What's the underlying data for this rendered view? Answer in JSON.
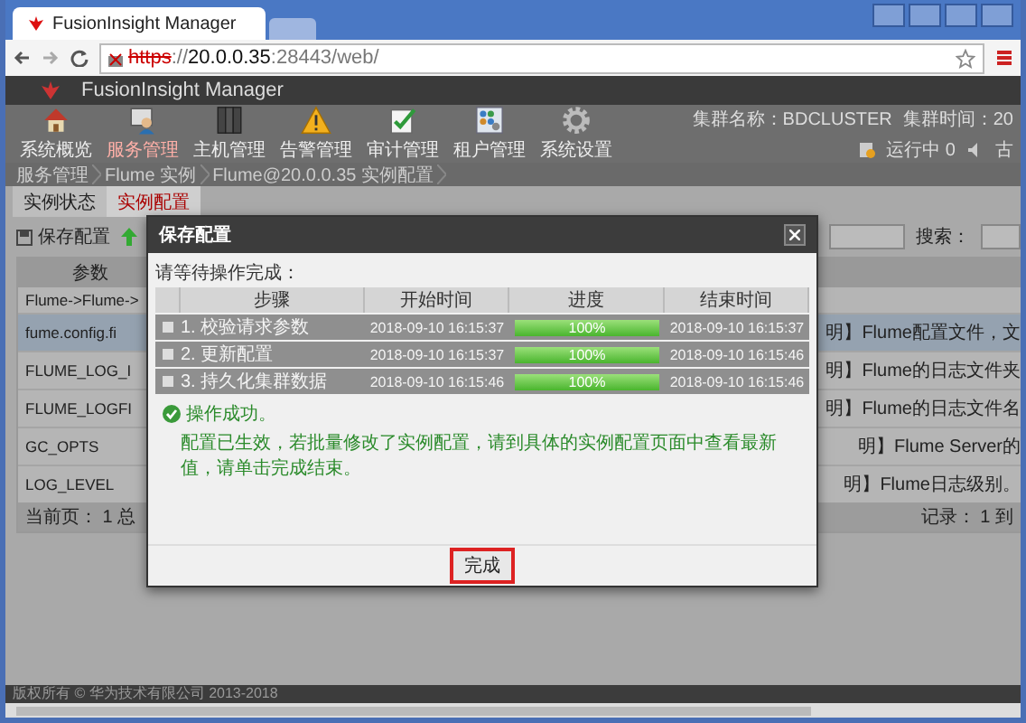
{
  "browser": {
    "tab_title": "FusionInsight Manager",
    "url_scheme": "https",
    "url_sep": "://",
    "url_host": "20.0.0.35",
    "url_rest": ":28443/web/"
  },
  "app": {
    "title": "FusionInsight Manager"
  },
  "nav": [
    {
      "kind": "home",
      "label": "系统概览",
      "selected": false
    },
    {
      "kind": "service",
      "label": "服务管理",
      "selected": true
    },
    {
      "kind": "host",
      "label": "主机管理",
      "selected": false
    },
    {
      "kind": "alarm",
      "label": "告警管理",
      "selected": false
    },
    {
      "kind": "audit",
      "label": "审计管理",
      "selected": false
    },
    {
      "kind": "tenant",
      "label": "租户管理",
      "selected": false
    },
    {
      "kind": "settings",
      "label": "系统设置",
      "selected": false
    }
  ],
  "cluster": {
    "name": "集群名称：BDCLUSTER",
    "time": "集群时间：20",
    "running": "运行中 0",
    "extra": "古"
  },
  "breadcrumb": [
    "服务管理",
    "Flume 实例",
    "Flume@20.0.0.35 实例配置"
  ],
  "page_tabs": [
    {
      "label": "实例状态",
      "selected": false
    },
    {
      "label": "实例配置",
      "selected": true
    }
  ],
  "toolbar": {
    "save": "保存配置",
    "search_label": "搜索："
  },
  "table": {
    "header": "参数",
    "group": "Flume->Flume->",
    "rows": [
      {
        "name": "fume.config.fi",
        "description": "明】Flume配置文件，文",
        "selected": true
      },
      {
        "name": "FLUME_LOG_I",
        "description": "明】Flume的日志文件夹",
        "selected": false
      },
      {
        "name": "FLUME_LOGFI",
        "description": "明】Flume的日志文件名",
        "selected": false
      },
      {
        "name": "GC_OPTS",
        "description": "明】Flume Server的",
        "selected": false
      },
      {
        "name": "LOG_LEVEL",
        "description": "明】Flume日志级别。",
        "selected": false
      }
    ],
    "footer_left": "当前页： 1 总",
    "footer_right": "记录： 1 到"
  },
  "dialog": {
    "title": "保存配置",
    "prompt": "请等待操作完成：",
    "columns": [
      "步骤",
      "开始时间",
      "进度",
      "结束时间"
    ],
    "steps": [
      {
        "label": "1. 校验请求参数",
        "start": "2018-09-10 16:15:37",
        "level": 1,
        "percent": "100%",
        "end": "2018-09-10 16:15:37"
      },
      {
        "label": "2. 更新配置",
        "start": "2018-09-10 16:15:37",
        "level": 1,
        "percent": "100%",
        "end": "2018-09-10 16:15:46"
      },
      {
        "label": "3. 持久化集群数据",
        "start": "2018-09-10 16:15:46",
        "level": 1,
        "percent": "100%",
        "end": "2018-09-10 16:15:46"
      }
    ],
    "result_title": "操作成功。",
    "result_message": "配置已生效，若批量修改了实例配置，请到具体的实例配置页面中查看最新值，请单击完成结束。",
    "button": "完成"
  },
  "copyright": "版权所有 © 华为技术有限公司 2013-2018"
}
